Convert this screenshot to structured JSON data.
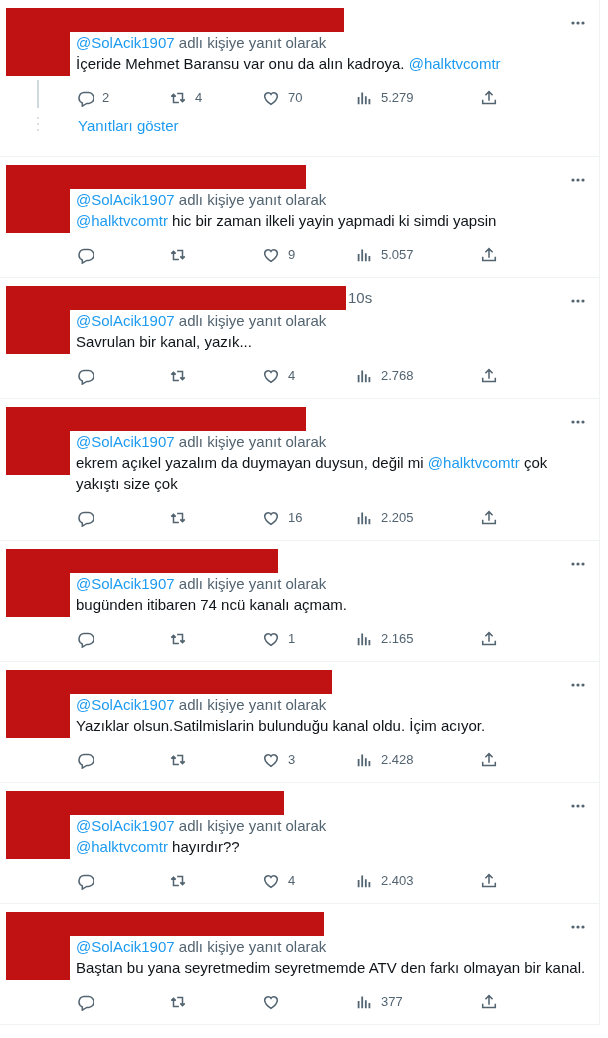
{
  "replies": [
    {
      "reply_to": "@SolAcik1907",
      "reply_suffix": "adlı kişiye yanıt olarak",
      "text": [
        {
          "kind": "text",
          "text": "İçeride Mehmet Baransu var onu da alın kadroya. "
        },
        {
          "kind": "mention",
          "text": "@halktvcomtr"
        }
      ],
      "stats": {
        "replies": "2",
        "retweets": "4",
        "likes": "70",
        "views": "5.279"
      },
      "thread": true,
      "show_replies": "Yanıtları göster"
    },
    {
      "reply_to": "@SolAcik1907",
      "reply_suffix": "adlı kişiye yanıt olarak",
      "text": [
        {
          "kind": "mention",
          "text": "@halktvcomtr"
        },
        {
          "kind": "text",
          "text": " hic bir zaman ilkeli yayin yapmadi ki simdi yapsin"
        }
      ],
      "stats": {
        "likes": "9",
        "views": "5.057"
      },
      "thread": false
    },
    {
      "time": "10s",
      "reply_to": "@SolAcik1907",
      "reply_suffix": "adlı kişiye yanıt olarak",
      "text": [
        {
          "kind": "text",
          "text": "Savrulan bir kanal, yazık..."
        }
      ],
      "stats": {
        "likes": "4",
        "views": "2.768"
      },
      "thread": false
    },
    {
      "reply_to": "@SolAcik1907",
      "reply_suffix": "adlı kişiye yanıt olarak",
      "text": [
        {
          "kind": "text",
          "text": "ekrem açıkel yazalım da duymayan duysun, değil mi "
        },
        {
          "kind": "mention",
          "text": "@halktvcomtr"
        },
        {
          "kind": "text",
          "text": " çok yakıştı size çok"
        }
      ],
      "stats": {
        "likes": "16",
        "views": "2.205"
      },
      "thread": false
    },
    {
      "reply_to": "@SolAcik1907",
      "reply_suffix": "adlı kişiye yanıt olarak",
      "text": [
        {
          "kind": "text",
          "text": "bugünden itibaren 74 ncü kanalı açmam."
        }
      ],
      "stats": {
        "likes": "1",
        "views": "2.165"
      },
      "thread": false
    },
    {
      "reply_to": "@SolAcik1907",
      "reply_suffix": "adlı kişiye yanıt olarak",
      "text": [
        {
          "kind": "text",
          "text": "Yazıklar olsun.Satilmislarin bulunduğu kanal oldu. İçim acıyor."
        }
      ],
      "stats": {
        "likes": "3",
        "views": "2.428"
      },
      "thread": false
    },
    {
      "reply_to": "@SolAcik1907",
      "reply_suffix": "adlı kişiye yanıt olarak",
      "text": [
        {
          "kind": "mention",
          "text": "@halktvcomtr"
        },
        {
          "kind": "text",
          "text": " hayırdır??"
        }
      ],
      "stats": {
        "likes": "4",
        "views": "2.403"
      },
      "thread": false
    },
    {
      "reply_to": "@SolAcik1907",
      "reply_suffix": "adlı kişiye yanıt olarak",
      "text": [
        {
          "kind": "text",
          "text": "Baştan bu yana seyretmedim seyretmemde ATV den farkı olmayan bir kanal."
        }
      ],
      "stats": {
        "views": "377"
      },
      "thread": false
    }
  ]
}
